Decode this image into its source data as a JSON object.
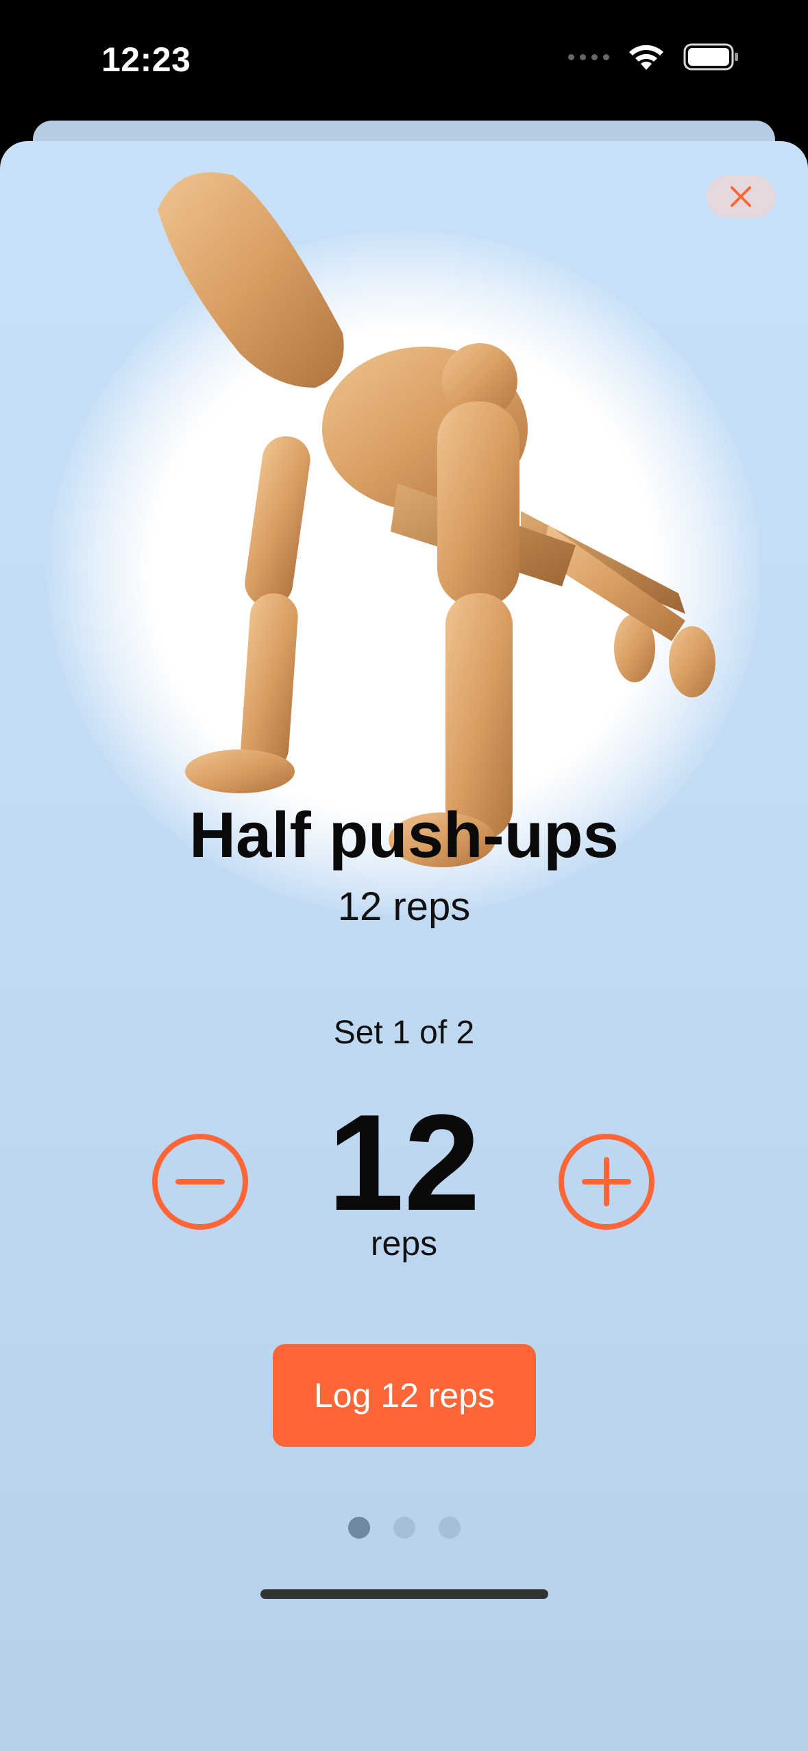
{
  "status_bar": {
    "time": "12:23"
  },
  "exercise": {
    "title": "Half push-ups",
    "target": "12 reps"
  },
  "set": {
    "label": "Set 1 of 2"
  },
  "counter": {
    "value": "12",
    "unit": "reps"
  },
  "log_button": {
    "label": "Log 12 reps"
  },
  "pagination": {
    "total": 3,
    "current": 1
  },
  "colors": {
    "accent": "#ff6637",
    "sheet_top": "#c8e1f8",
    "sheet_bottom": "#b6d0ec"
  },
  "icons": {
    "close": "close-icon",
    "minus": "minus-circle-icon",
    "plus": "plus-circle-icon",
    "wifi": "wifi-icon",
    "battery": "battery-icon"
  }
}
